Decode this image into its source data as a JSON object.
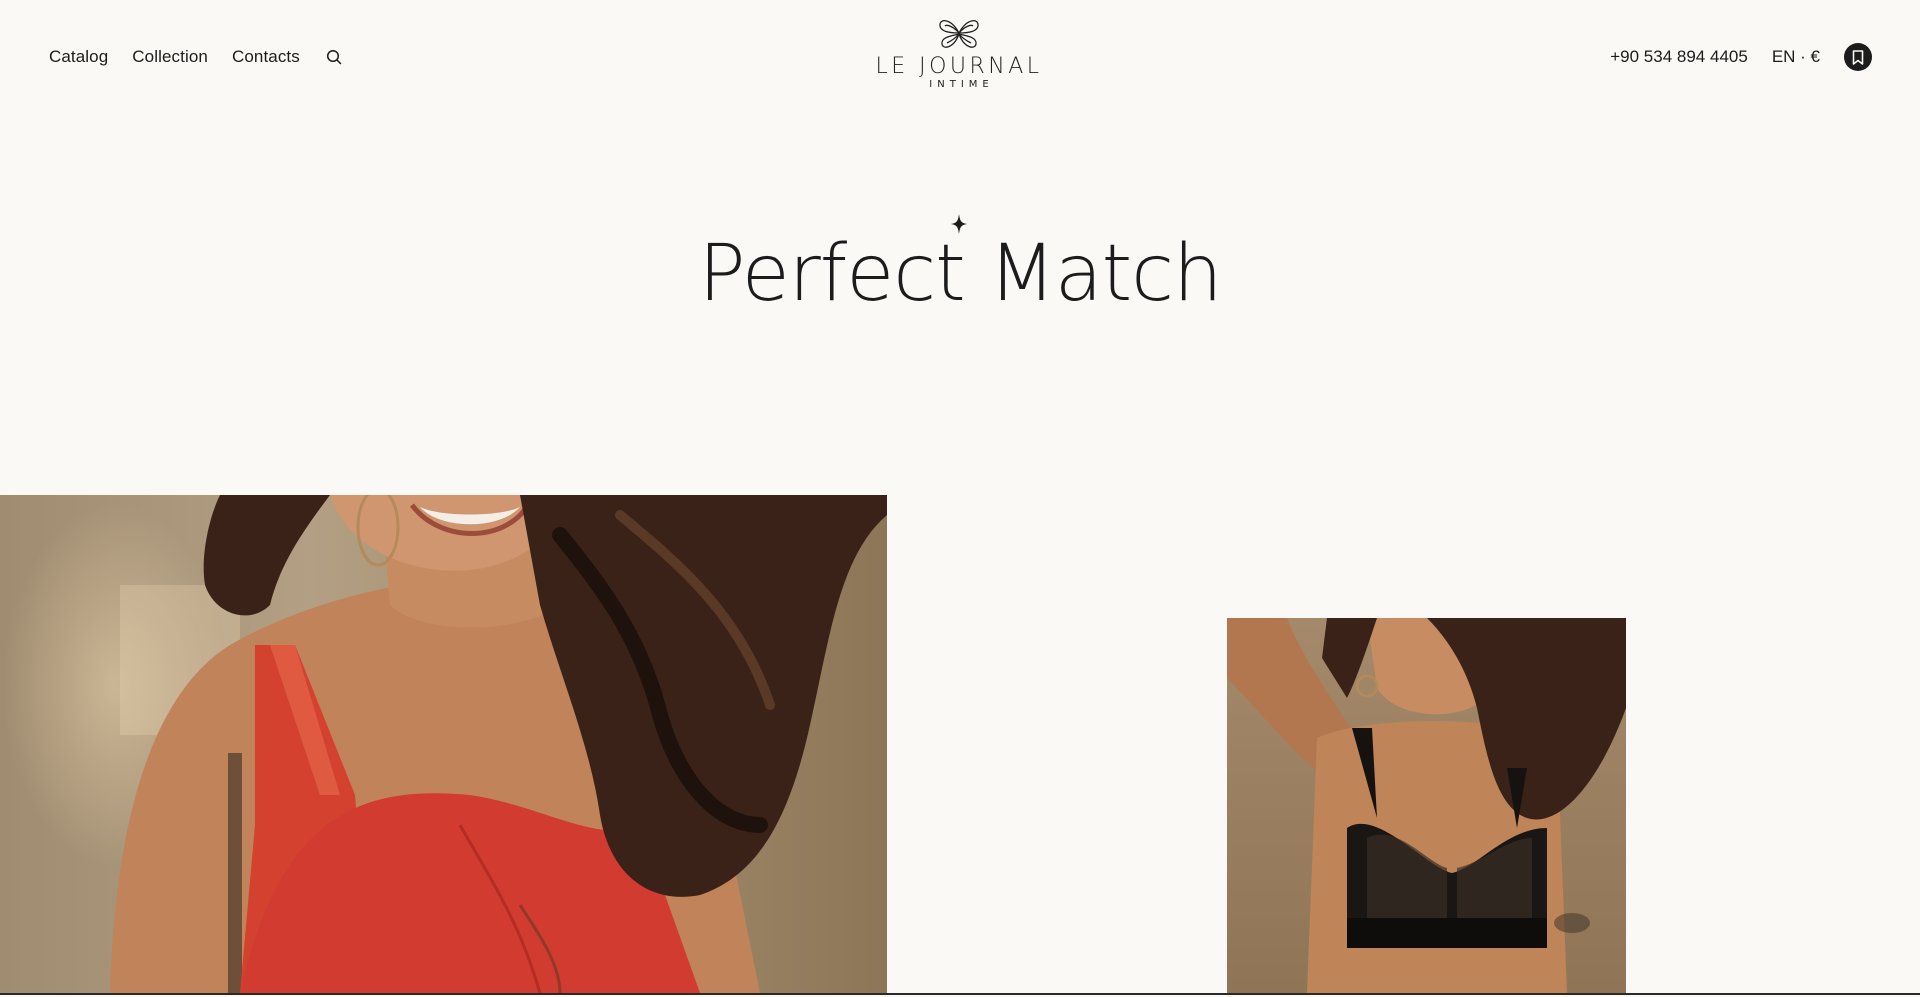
{
  "nav": {
    "left_links": [
      "Catalog",
      "Collection",
      "Contacts"
    ],
    "search_icon": "search-icon",
    "phone": "+90 534 894 4405",
    "locale": "EN · €",
    "bookmark_icon": "bookmark-icon"
  },
  "logo": {
    "name": "LE JOURNAL",
    "subtitle": "INTIME",
    "mark_icon": "butterfly-logo-icon"
  },
  "hero": {
    "sparkle_icon": "sparkle-icon",
    "title": "Perfect Match"
  },
  "gallery": {
    "left_photo": "model-red-bra-photo",
    "right_photo": "model-black-bra-photo"
  },
  "colors": {
    "background": "#faf9f6",
    "text": "#1c1c1c",
    "accent_red": "#d23b30"
  }
}
